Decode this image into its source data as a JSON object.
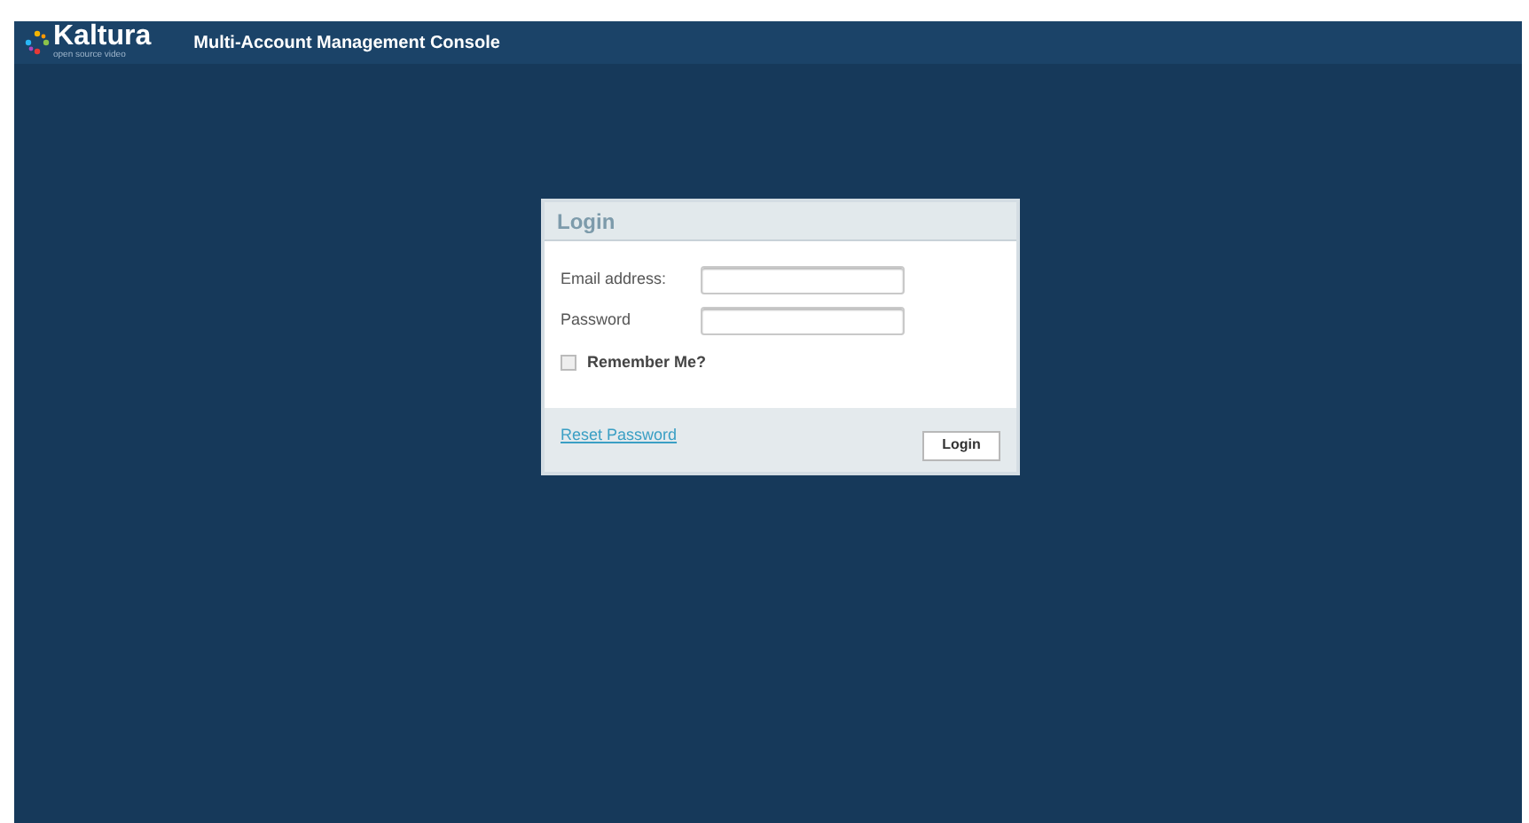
{
  "header": {
    "logo": "Kaltura",
    "logo_tagline": "open source video",
    "title": "Multi-Account Management Console"
  },
  "login": {
    "title": "Login",
    "email_label": "Email address:",
    "password_label": "Password",
    "remember": {
      "label": "Remember Me?",
      "checked": false
    },
    "reset_link": "Reset Password",
    "submit": "Login"
  }
}
